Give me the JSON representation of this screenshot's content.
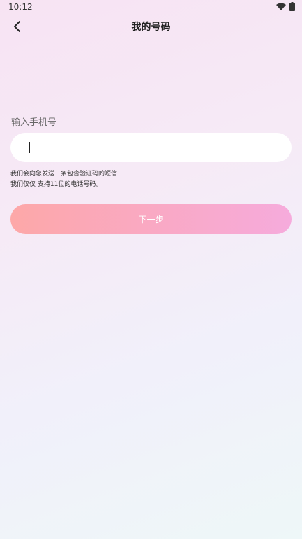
{
  "status_bar": {
    "time": "10:12",
    "icons": [
      "wifi-icon",
      "battery-icon"
    ]
  },
  "header": {
    "back_icon": "chevron-left-icon",
    "title": "我的号码"
  },
  "form": {
    "phone_label": "输入手机号",
    "phone_value": "",
    "hint_line_1": "我们会向您发送一条包含验证码的短信",
    "hint_line_2": "我们仅仅 支持11位的电话号码。",
    "next_label": "下一步"
  },
  "colors": {
    "button_gradient_start": "#fda8a8",
    "button_gradient_end": "#f6abdc",
    "input_background": "#ffffff"
  }
}
